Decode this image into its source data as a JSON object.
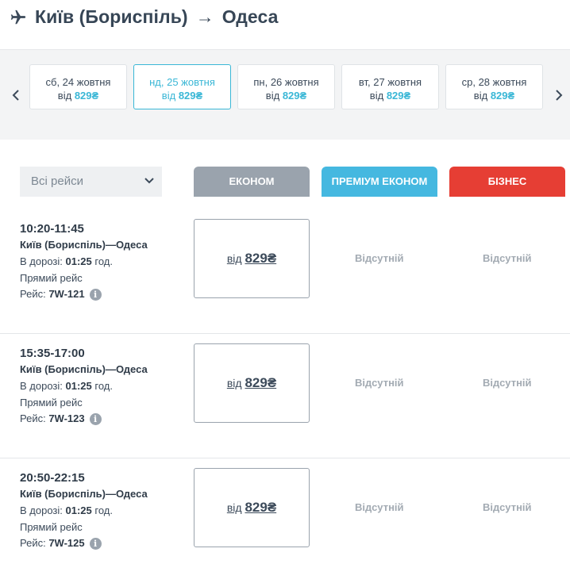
{
  "header": {
    "from": "Київ (Бориспіль)",
    "arrow": "→",
    "to": "Одеса"
  },
  "dates": [
    {
      "date": "сб, 24 жовтня",
      "from_label": "від",
      "price": "829₴",
      "active": false
    },
    {
      "date": "нд, 25 жовтня",
      "from_label": "від",
      "price": "829₴",
      "active": true
    },
    {
      "date": "пн, 26 жовтня",
      "from_label": "від",
      "price": "829₴",
      "active": false
    },
    {
      "date": "вт, 27 жовтня",
      "from_label": "від",
      "price": "829₴",
      "active": false
    },
    {
      "date": "ср, 28 жовтня",
      "from_label": "від",
      "price": "829₴",
      "active": false
    }
  ],
  "filter": {
    "selected": "Всі рейси"
  },
  "tabs": {
    "econom": "ЕКОНОМ",
    "premium": "ПРЕМІУМ ЕКОНОМ",
    "business": "БІЗНЕС"
  },
  "flights": [
    {
      "time": "10:20-11:45",
      "route": "Київ (Бориспіль)—Одеса",
      "duration_label": "В дорозі:",
      "duration": "01:25",
      "duration_unit": "год.",
      "type": "Прямий рейс",
      "flight_label": "Рейс:",
      "flight_no": "7W-121",
      "econom_from": "від",
      "econom_price": "829₴",
      "premium": "Відсутній",
      "business": "Відсутній"
    },
    {
      "time": "15:35-17:00",
      "route": "Київ (Бориспіль)—Одеса",
      "duration_label": "В дорозі:",
      "duration": "01:25",
      "duration_unit": "год.",
      "type": "Прямий рейс",
      "flight_label": "Рейс:",
      "flight_no": "7W-123",
      "econom_from": "від",
      "econom_price": "829₴",
      "premium": "Відсутній",
      "business": "Відсутній"
    },
    {
      "time": "20:50-22:15",
      "route": "Київ (Бориспіль)—Одеса",
      "duration_label": "В дорозі:",
      "duration": "01:25",
      "duration_unit": "год.",
      "type": "Прямий рейс",
      "flight_label": "Рейс:",
      "flight_no": "7W-125",
      "econom_from": "від",
      "econom_price": "829₴",
      "premium": "Відсутній",
      "business": "Відсутній"
    }
  ],
  "colors": {
    "accent": "#3ab7d6",
    "econom": "#9aa3ad",
    "premium": "#45b8e0",
    "business": "#e63e34"
  },
  "icons": {
    "plane": "plane-icon",
    "prev": "chevron-left-icon",
    "next": "chevron-right-icon",
    "dropdown": "chevron-down-icon",
    "info": "info-icon"
  }
}
